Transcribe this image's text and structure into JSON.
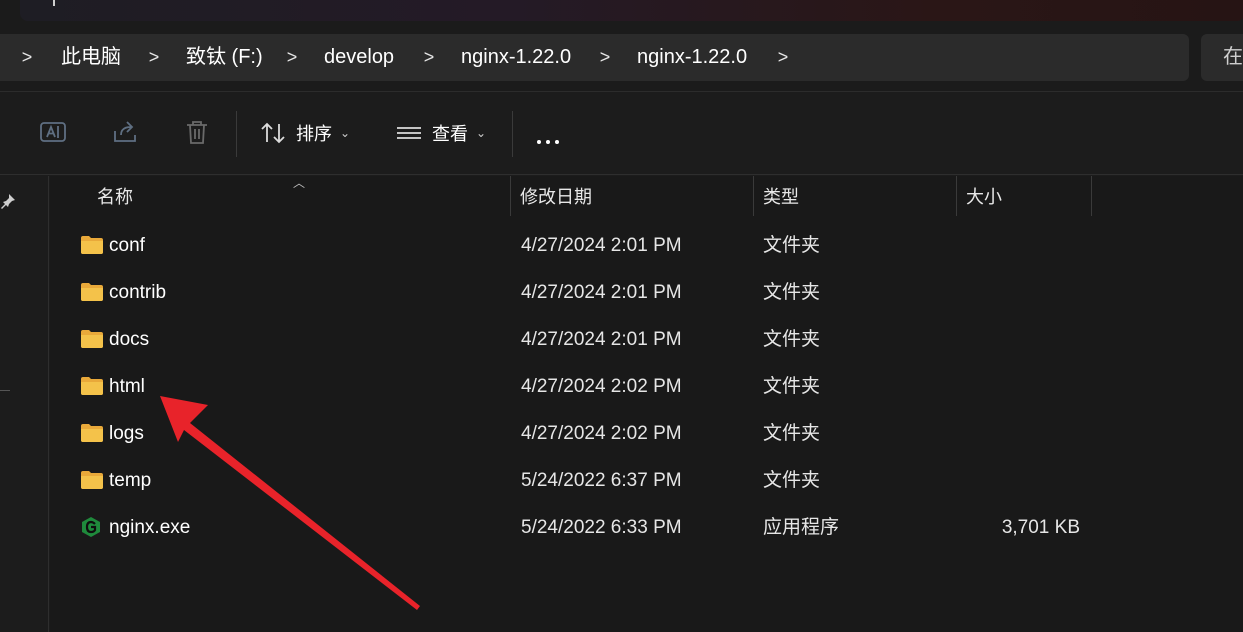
{
  "breadcrumb": {
    "items": [
      "此电脑",
      "致钛 (F:)",
      "develop",
      "nginx-1.22.0",
      "nginx-1.22.0"
    ],
    "separator": ">"
  },
  "search": {
    "text": "在"
  },
  "toolbar": {
    "sort_label": "排序",
    "view_label": "查看",
    "chevron": "⌄"
  },
  "columns": {
    "name": "名称",
    "modified": "修改日期",
    "type": "类型",
    "size": "大小"
  },
  "files": [
    {
      "name": "conf",
      "modified": "4/27/2024 2:01 PM",
      "type": "文件夹",
      "size": "",
      "icon": "folder-icon"
    },
    {
      "name": "contrib",
      "modified": "4/27/2024 2:01 PM",
      "type": "文件夹",
      "size": "",
      "icon": "folder-icon"
    },
    {
      "name": "docs",
      "modified": "4/27/2024 2:01 PM",
      "type": "文件夹",
      "size": "",
      "icon": "folder-icon"
    },
    {
      "name": "html",
      "modified": "4/27/2024 2:02 PM",
      "type": "文件夹",
      "size": "",
      "icon": "folder-icon"
    },
    {
      "name": "logs",
      "modified": "4/27/2024 2:02 PM",
      "type": "文件夹",
      "size": "",
      "icon": "folder-icon"
    },
    {
      "name": "temp",
      "modified": "5/24/2022 6:37 PM",
      "type": "文件夹",
      "size": "",
      "icon": "folder-icon"
    },
    {
      "name": "nginx.exe",
      "modified": "5/24/2022 6:33 PM",
      "type": "应用程序",
      "size": "3,701 KB",
      "icon": "nginx-app-icon"
    }
  ],
  "colors": {
    "background": "#191919",
    "folder": "#f4c24a",
    "annotation_arrow": "#e8232a",
    "nginx_icon": "#1f8a3c"
  }
}
